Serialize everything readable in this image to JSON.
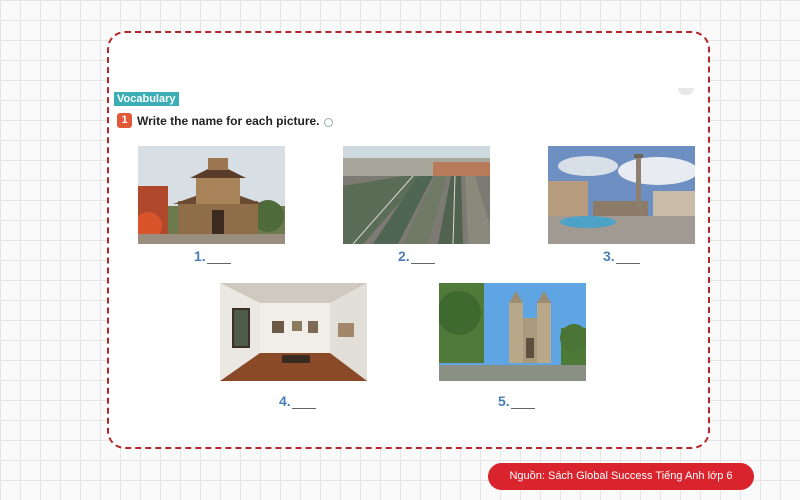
{
  "section_tag": "Vocabulary",
  "task": {
    "number": "1",
    "instruction": "Write the name for each picture."
  },
  "pictures": [
    {
      "label": "1."
    },
    {
      "label": "2."
    },
    {
      "label": "3."
    },
    {
      "label": "4."
    },
    {
      "label": "5."
    }
  ],
  "source_badge": "Nguồn: Sách Global Success Tiếng Anh lớp 6",
  "colors": {
    "border": "#b5262b",
    "tag": "#3aaeb4",
    "task_number": "#e2593a",
    "label": "#4a7fb5",
    "badge": "#d9232d"
  },
  "icons": [
    "audio-icon",
    "pagoda-photo",
    "railway-station-photo",
    "city-square-photo",
    "art-gallery-photo",
    "cathedral-photo"
  ]
}
